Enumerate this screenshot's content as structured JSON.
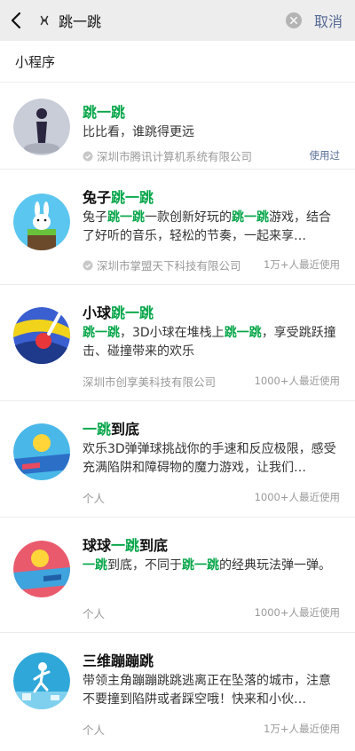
{
  "search": {
    "query": "跳一跳",
    "cancel_label": "取消"
  },
  "section": {
    "title": "小程序"
  },
  "colors": {
    "highlight": "#07a64a",
    "link": "#576b95",
    "meta": "#9a9a9a"
  },
  "results": [
    {
      "icon": "tall-figure-icon",
      "title": [
        {
          "t": "跳一跳",
          "h": true
        }
      ],
      "desc": [
        {
          "t": "比比看，谁跳得更远",
          "h": false
        }
      ],
      "org": "深圳市腾讯计算机系统有限公司",
      "verified": true,
      "stat": "使用过"
    },
    {
      "icon": "rabbit-icon",
      "title": [
        {
          "t": "兔子",
          "h": false
        },
        {
          "t": "跳一跳",
          "h": true
        }
      ],
      "desc": [
        {
          "t": "兔子",
          "h": false
        },
        {
          "t": "跳一跳",
          "h": true
        },
        {
          "t": "一款创新好玩的",
          "h": false
        },
        {
          "t": "跳一跳",
          "h": true
        },
        {
          "t": "游戏，结合了好听的音乐，轻松的节奏，一起来享…",
          "h": false
        }
      ],
      "org": "深圳市掌盟天下科技有限公司",
      "verified": true,
      "stat": "1万+人最近使用"
    },
    {
      "icon": "helix-ball-icon",
      "title": [
        {
          "t": "小球",
          "h": false
        },
        {
          "t": "跳一跳",
          "h": true
        }
      ],
      "desc": [
        {
          "t": "跳一跳",
          "h": true
        },
        {
          "t": "，3D小球在堆栈上",
          "h": false
        },
        {
          "t": "跳一跳",
          "h": true
        },
        {
          "t": "，享受跳跃撞击、碰撞带来的欢乐",
          "h": false
        }
      ],
      "org": "深圳市创享美科技有限公司",
      "verified": false,
      "stat": "1000+人最近使用"
    },
    {
      "icon": "bouncing-ball-icon",
      "title": [
        {
          "t": "一跳",
          "h": true
        },
        {
          "t": "到底",
          "h": false
        }
      ],
      "desc": [
        {
          "t": "欢乐3D弹弹球挑战你的手速和反应极限，感受充满陷阱和障碍物的魔力游戏，让我们…",
          "h": false
        }
      ],
      "org": "个人",
      "verified": false,
      "stat": "1000+人最近使用"
    },
    {
      "icon": "bouncing-ball-icon",
      "title": [
        {
          "t": "球球",
          "h": false
        },
        {
          "t": "一跳",
          "h": true
        },
        {
          "t": "到底",
          "h": false
        }
      ],
      "desc": [
        {
          "t": "一跳",
          "h": true
        },
        {
          "t": "到底，不同于",
          "h": false
        },
        {
          "t": "跳一跳",
          "h": true
        },
        {
          "t": "的经典玩法弹一弹。",
          "h": false
        }
      ],
      "org": "个人",
      "verified": false,
      "stat": "1000+人最近使用"
    },
    {
      "icon": "running-figure-icon",
      "title": [
        {
          "t": "三维蹦蹦跳",
          "h": false
        }
      ],
      "desc": [
        {
          "t": "带领主角蹦蹦跳跳逃离正在坠落的城市，注意不要撞到陷阱或者踩空哦！快来和小伙…",
          "h": false
        }
      ],
      "org": "个人",
      "verified": false,
      "stat": "1万+人最近使用"
    }
  ]
}
